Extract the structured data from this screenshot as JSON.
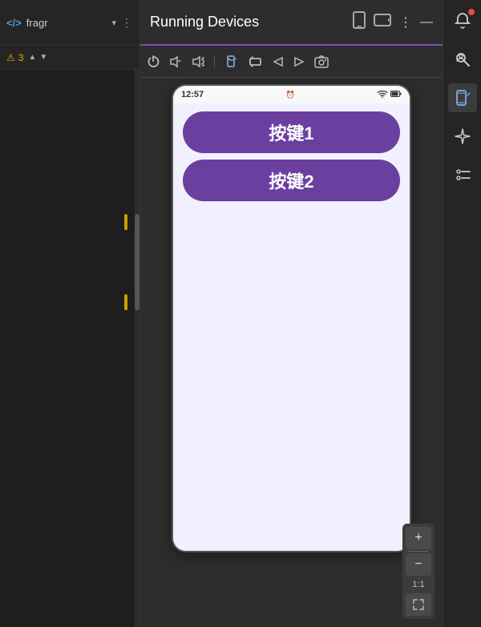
{
  "header": {
    "title": "Running Devices",
    "project_name": "fragr",
    "warning_count": "3"
  },
  "toolbar": {
    "buttons": [
      "power",
      "volume-down",
      "volume-up",
      "rotate-portrait",
      "rotate-landscape",
      "back-nav",
      "forward-nav",
      "screenshot"
    ]
  },
  "phone": {
    "status_time": "12:57",
    "button1_label": "按键1",
    "button2_label": "按键2"
  },
  "zoom": {
    "plus_label": "+",
    "minus_label": "−",
    "ratio_label": "1:1"
  },
  "right_panel": {
    "icons": [
      "notification",
      "person-search",
      "device-frame",
      "sparkle",
      "list-settings"
    ]
  }
}
